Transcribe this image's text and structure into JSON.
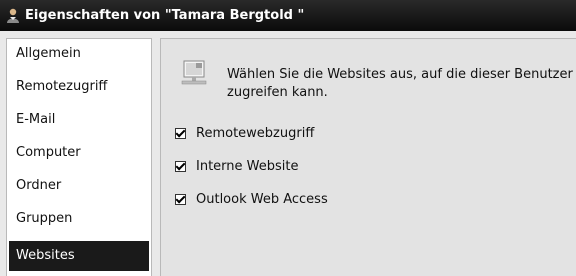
{
  "window": {
    "title": "Eigenschaften von \"Tamara Bergtold \""
  },
  "sidebar": {
    "items": [
      {
        "label": "Allgemein",
        "active": false
      },
      {
        "label": "Remotezugriff",
        "active": false
      },
      {
        "label": "E-Mail",
        "active": false
      },
      {
        "label": "Computer",
        "active": false
      },
      {
        "label": "Ordner",
        "active": false
      },
      {
        "label": "Gruppen",
        "active": false
      },
      {
        "label": "Websites",
        "active": true
      }
    ]
  },
  "content": {
    "description": "Wählen Sie die Websites aus, auf die dieser Benutzer zugreifen kann.",
    "options": [
      {
        "label": "Remotewebzugriff",
        "checked": true
      },
      {
        "label": "Interne Website",
        "checked": true
      },
      {
        "label": "Outlook Web Access",
        "checked": true
      }
    ]
  }
}
